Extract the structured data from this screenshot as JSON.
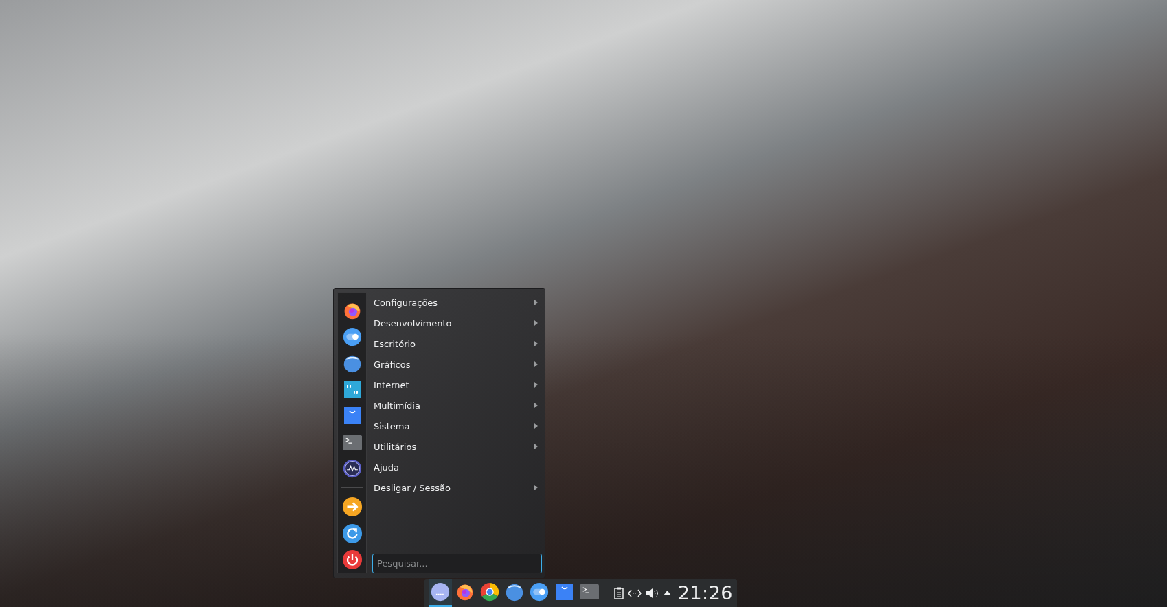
{
  "menu": {
    "categories": [
      {
        "label": "Configurações",
        "has_submenu": true
      },
      {
        "label": "Desenvolvimento",
        "has_submenu": true
      },
      {
        "label": "Escritório",
        "has_submenu": true
      },
      {
        "label": "Gráficos",
        "has_submenu": true
      },
      {
        "label": "Internet",
        "has_submenu": true
      },
      {
        "label": "Multimídia",
        "has_submenu": true
      },
      {
        "label": "Sistema",
        "has_submenu": true
      },
      {
        "label": "Utilitários",
        "has_submenu": true
      },
      {
        "label": "Ajuda",
        "has_submenu": false
      },
      {
        "label": "Desligar / Sessão",
        "has_submenu": true
      }
    ],
    "search": {
      "placeholder": "Pesquisar..."
    }
  },
  "taskbar": {
    "tasks": [
      {
        "selected": true
      },
      {
        "selected": false
      },
      {
        "selected": false
      },
      {
        "selected": false
      },
      {
        "selected": false
      },
      {
        "selected": false
      },
      {
        "selected": false
      }
    ],
    "clock": "21:26"
  }
}
